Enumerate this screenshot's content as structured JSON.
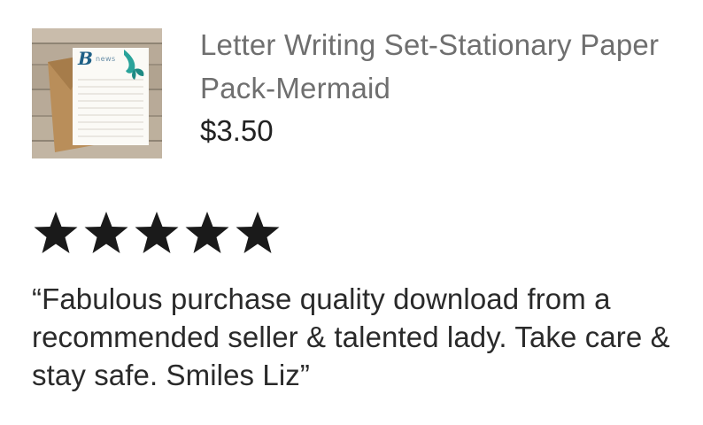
{
  "listing": {
    "title": "Letter Writing Set-Stationary Paper Pack-Mermaid",
    "price": "$3.50",
    "thumbnail": {
      "letter": "B",
      "stamp_text": "news",
      "icon": "mermaid-tail-icon"
    }
  },
  "rating": {
    "value": 5,
    "max": 5,
    "star_icon": "star-icon",
    "color": "#1a1a1a"
  },
  "review": {
    "text": "“Fabulous purchase quality download from a recommended seller & talented lady. Take care & stay safe. Smiles Liz”"
  }
}
